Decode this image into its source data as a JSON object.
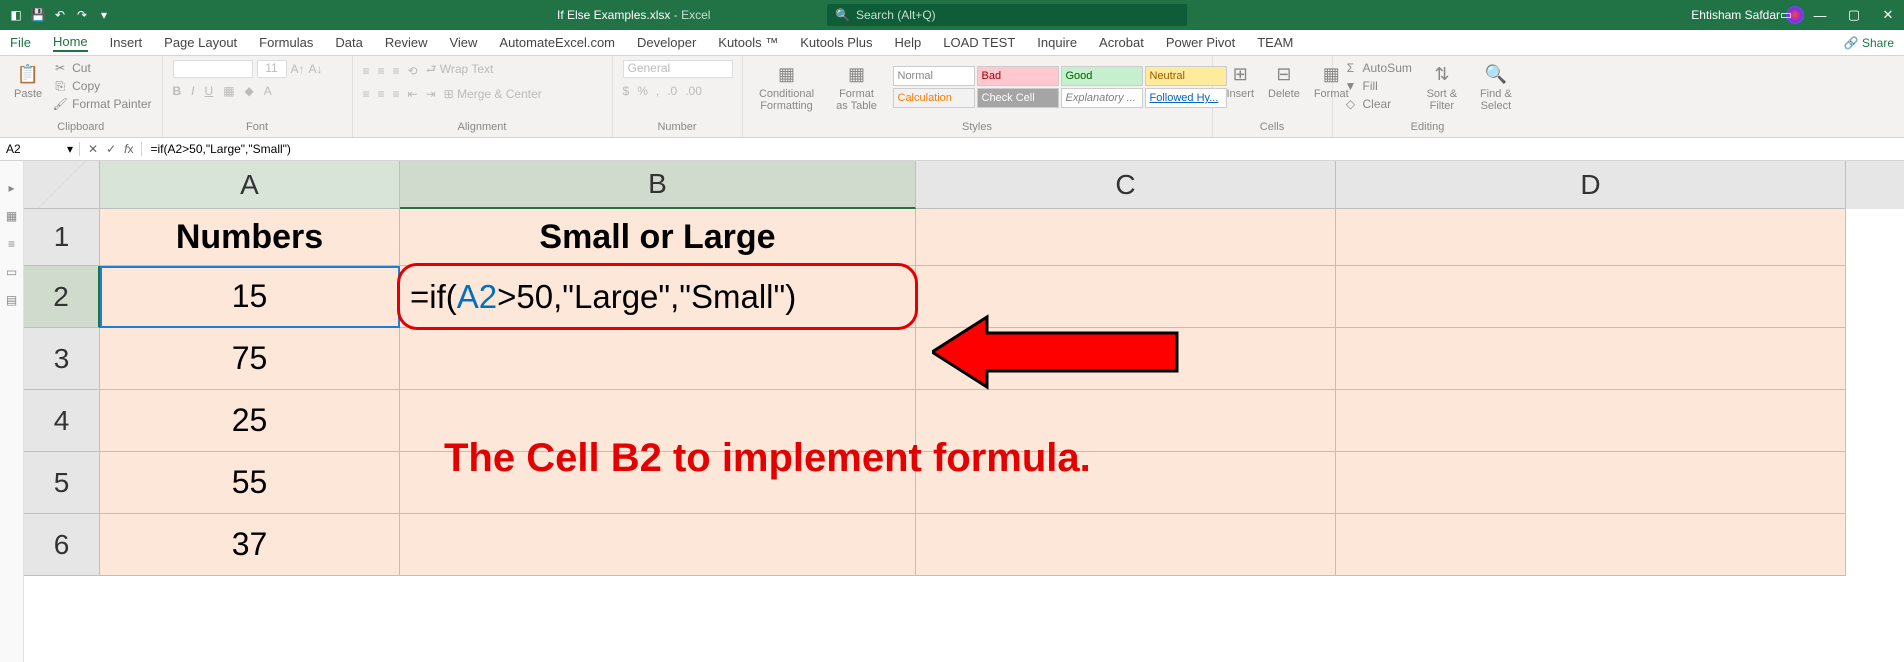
{
  "titlebar": {
    "filename": "If Else Examples.xlsx",
    "app": "Excel",
    "search_placeholder": "Search (Alt+Q)",
    "username": "Ehtisham Safdar"
  },
  "menu": {
    "file": "File",
    "active": "Home",
    "items": [
      "Insert",
      "Page Layout",
      "Formulas",
      "Data",
      "Review",
      "View",
      "AutomateExcel.com",
      "Developer",
      "Kutools ™",
      "Kutools Plus",
      "Help",
      "LOAD TEST",
      "Inquire",
      "Acrobat",
      "Power Pivot",
      "TEAM"
    ],
    "share": "Share"
  },
  "ribbon": {
    "clipboard": {
      "paste": "Paste",
      "cut": "Cut",
      "copy": "Copy",
      "painter": "Format Painter",
      "label": "Clipboard"
    },
    "font": {
      "label": "Font",
      "size": "11"
    },
    "alignment": {
      "wrap": "Wrap Text",
      "merge": "Merge & Center",
      "label": "Alignment"
    },
    "number": {
      "general": "General",
      "label": "Number"
    },
    "styles": {
      "cond": "Conditional Formatting",
      "fmtTable": "Format as Table",
      "normal": "Normal",
      "bad": "Bad",
      "good": "Good",
      "neutral": "Neutral",
      "calc": "Calculation",
      "check": "Check Cell",
      "explan": "Explanatory ...",
      "hyper": "Followed Hy...",
      "label": "Styles"
    },
    "cells": {
      "insert": "Insert",
      "delete": "Delete",
      "format": "Format",
      "label": "Cells"
    },
    "editing": {
      "autosum": "AutoSum",
      "fill": "Fill",
      "clear": "Clear",
      "sort": "Sort & Filter",
      "find": "Find & Select",
      "label": "Editing"
    }
  },
  "formula_bar": {
    "name": "A2",
    "formula": "=if(A2>50,\"Large\",\"Small\")"
  },
  "columns": [
    "A",
    "B",
    "C",
    "D"
  ],
  "row_headers": [
    "1",
    "2",
    "3",
    "4",
    "5",
    "6"
  ],
  "headers": {
    "A": "Numbers",
    "B": "Small or Large"
  },
  "col_A": [
    "15",
    "75",
    "25",
    "55",
    "37"
  ],
  "formula_cell": {
    "pre": "=if(",
    "ref": "A2",
    "post": ">50,\"Large\",\"Small\")"
  },
  "annotation": "The Cell B2 to implement formula."
}
